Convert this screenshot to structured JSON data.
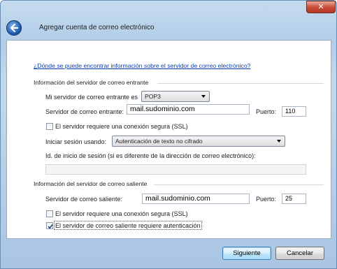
{
  "window": {
    "title": "Agregar cuenta de correo electrónico",
    "close_glyph": "✕"
  },
  "help_link": "¿Dónde se puede encontrar información sobre el servidor de correo electrónico?",
  "incoming": {
    "header": "Información del servidor de correo entrante",
    "server_type_label": "Mi servidor de correo entrante es",
    "server_type_value": "POP3",
    "server_label": "Servidor de correo entrante:",
    "server_value": "mail.sudominio.com",
    "port_label": "Puerto:",
    "port_value": "110",
    "ssl_label": "El servidor requiere una conexión segura (SSL)",
    "ssl_checked": false,
    "login_label": "Iniciar sesión usando:",
    "login_value": "Autenticación de texto no cifrado",
    "login_id_label": "Id. de inicio de sesión (si es diferente de la dirección de correo electrónico):",
    "login_id_value": ""
  },
  "outgoing": {
    "header": "Información del servidor de correo saliente",
    "server_label": "Servidor de correo saliente:",
    "server_value": "mail.sudominio.com",
    "port_label": "Puerto:",
    "port_value": "25",
    "ssl_label": "El servidor requiere una conexión segura (SSL)",
    "ssl_checked": false,
    "auth_label": "El servidor de correo saliente requiere autenticación",
    "auth_checked": true
  },
  "buttons": {
    "next": "Siguiente",
    "cancel": "Cancelar"
  },
  "colors": {
    "link": "#0a3fa8",
    "frame": "#b2cde8",
    "close": "#c74a36"
  }
}
